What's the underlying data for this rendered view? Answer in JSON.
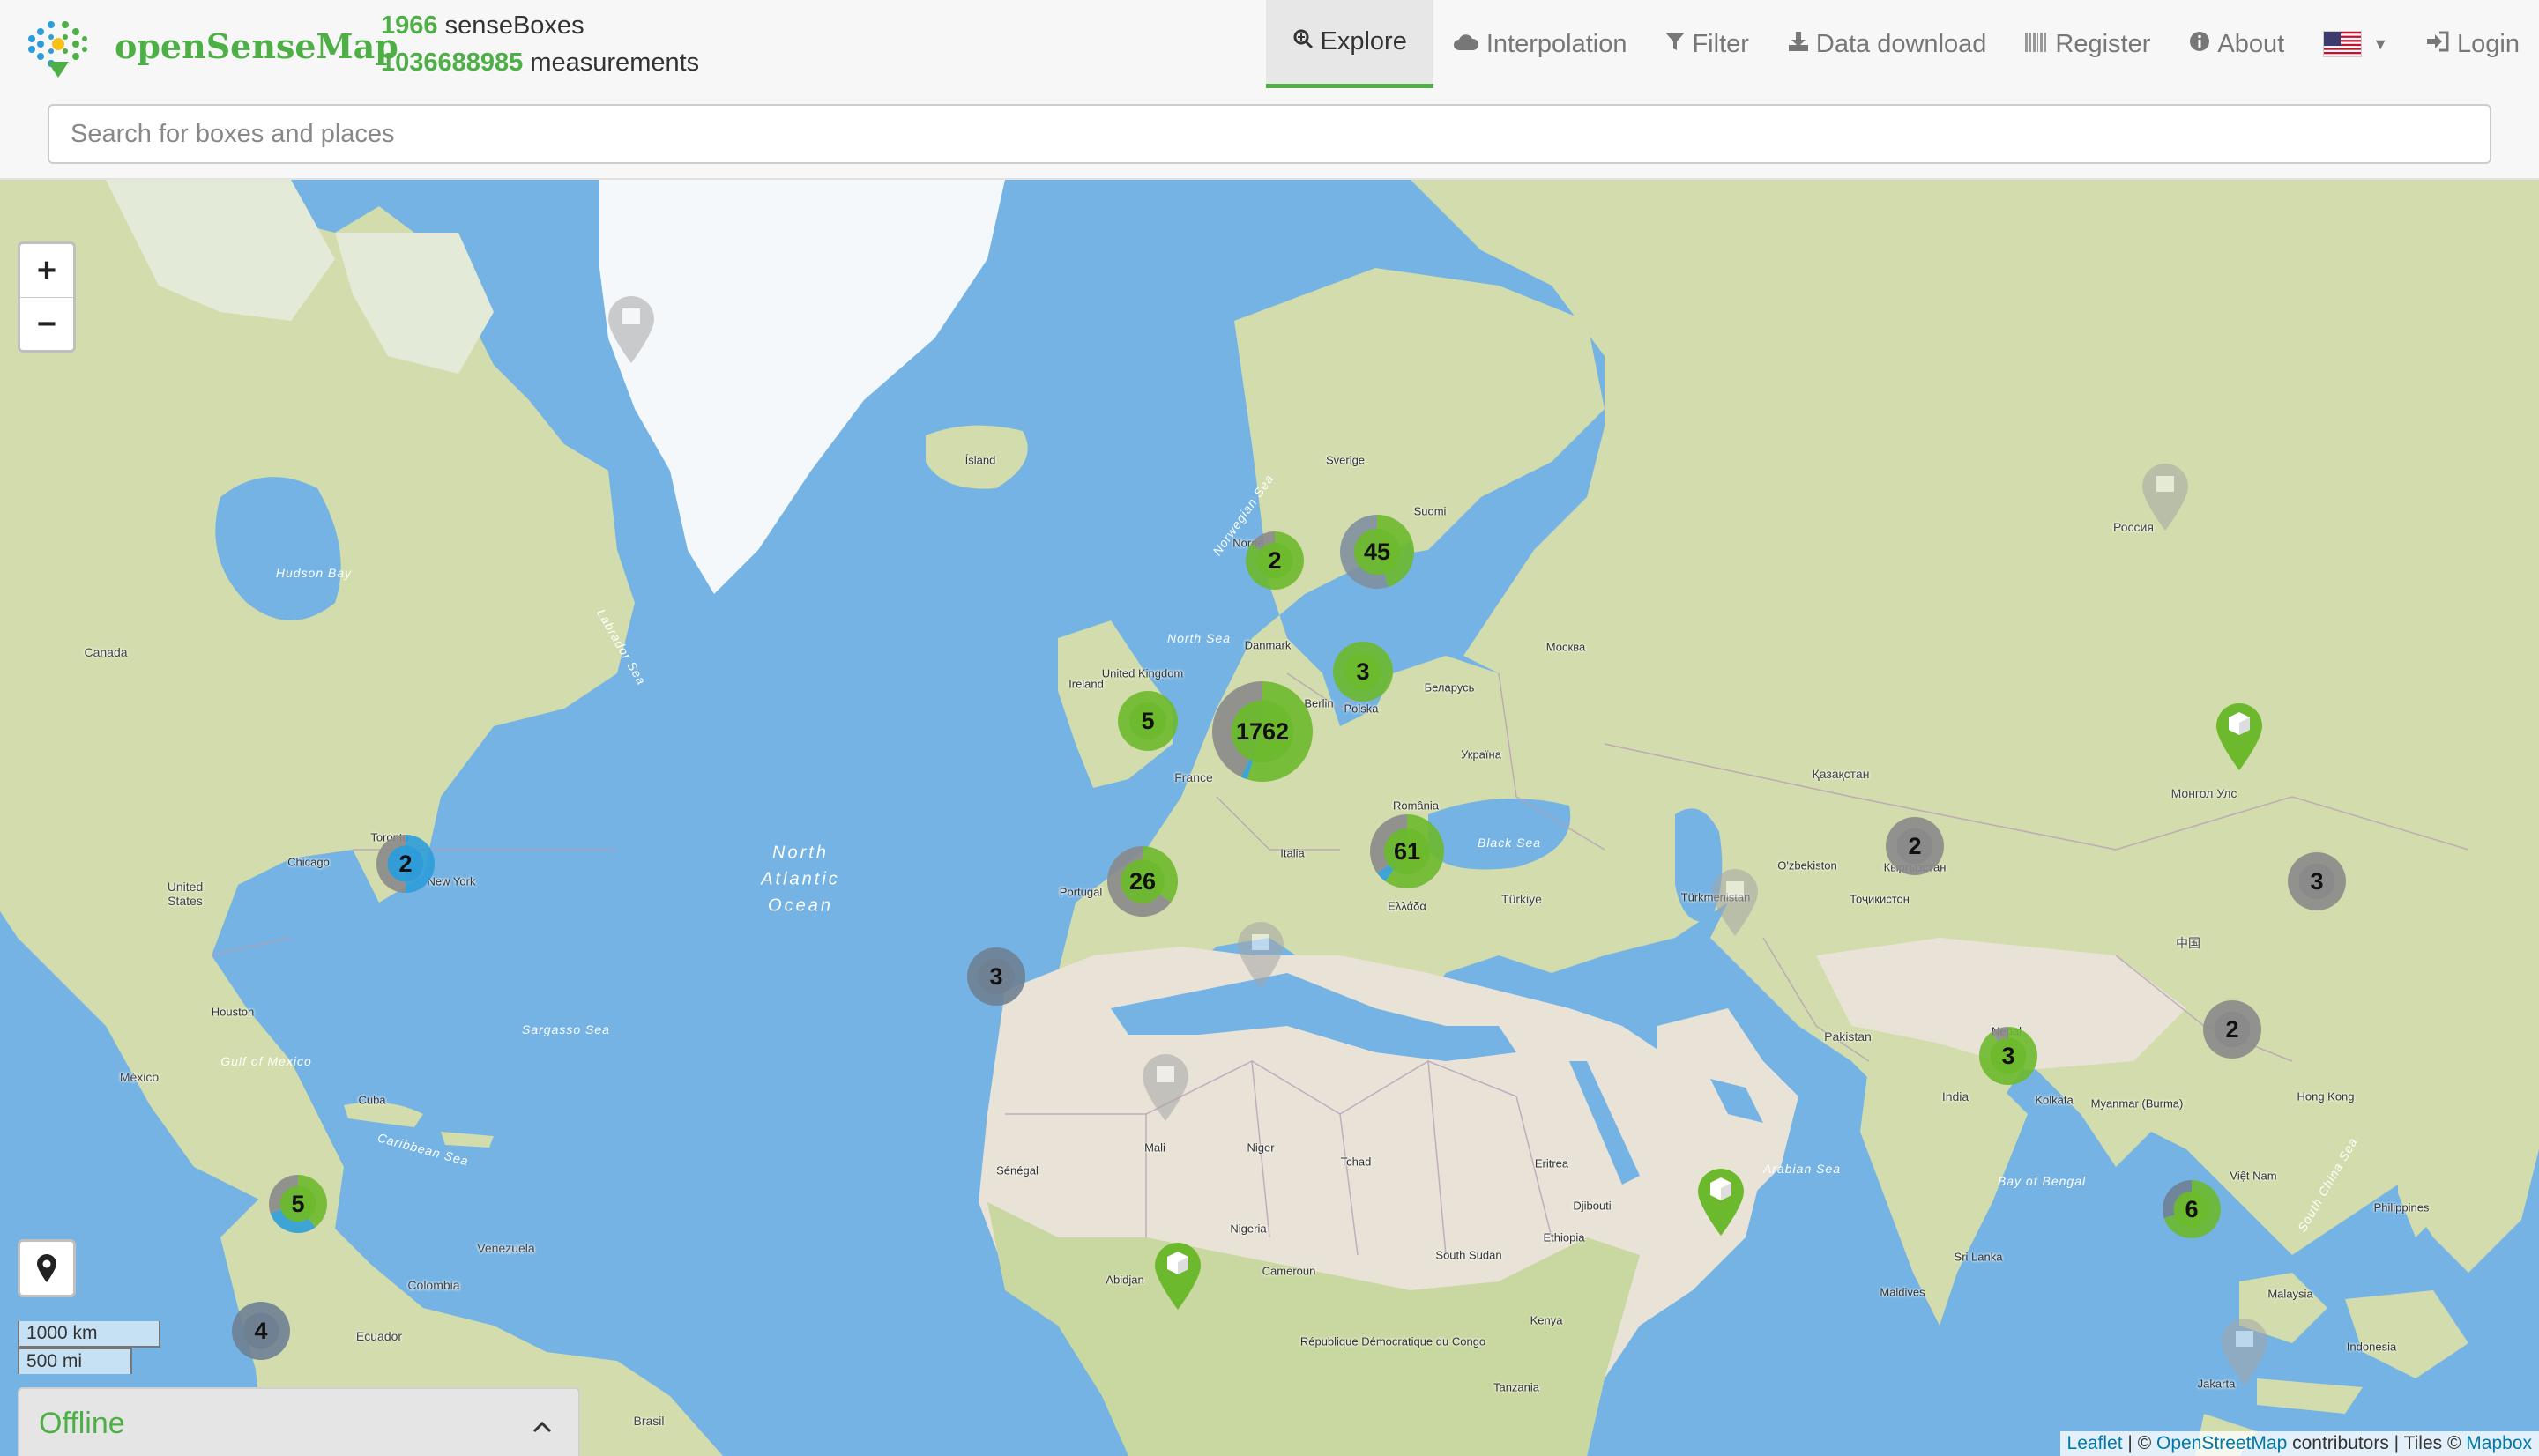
{
  "brand": {
    "name": "openSenseMap"
  },
  "stats": {
    "boxes_count": "1966",
    "boxes_label": "senseBoxes",
    "measurements_count": "1036688985",
    "measurements_label": "measurements"
  },
  "nav": {
    "explore": "Explore",
    "interpolation": "Interpolation",
    "filter": "Filter",
    "download": "Data download",
    "register": "Register",
    "about": "About",
    "login": "Login"
  },
  "search": {
    "placeholder": "Search for boxes and places",
    "value": ""
  },
  "map": {
    "zoom_in": "+",
    "zoom_out": "−",
    "scale_km": "1000 km",
    "scale_mi": "500 mi",
    "offline_label": "Offline",
    "offline_toggle": "⌃",
    "attribution": {
      "leaflet": "Leaflet",
      "separator": " | © ",
      "osm": "OpenStreetMap",
      "contributors": " contributors | Tiles © ",
      "mapbox": "Mapbox"
    },
    "clusters": [
      "2",
      "45",
      "5",
      "1762",
      "3",
      "2",
      "26",
      "61",
      "3",
      "5",
      "4",
      "2",
      "3",
      "2",
      "3",
      "6"
    ],
    "labels": {
      "north_atlantic_1": "North",
      "north_atlantic_2": "Atlantic",
      "north_atlantic_3": "Ocean",
      "labrador_sea": "Labrador Sea",
      "caribbean_sea": "Caribbean Sea",
      "arabian_sea": "Arabian Sea",
      "bay_of_bengal": "Bay of Bengal",
      "south_china_sea": "South China Sea",
      "norwegian_sea": "Norwegian Sea",
      "hudson_bay": "Hudson Bay",
      "gulf_of_mexico": "Gulf of Mexico",
      "sargasso_sea": "Sargasso Sea",
      "black_sea": "Black Sea",
      "north_sea": "North Sea",
      "canada": "Canada",
      "united_states_1": "United",
      "united_states_2": "States",
      "mexico": "México",
      "cuba": "Cuba",
      "venezuela": "Venezuela",
      "colombia": "Colombia",
      "ecuador": "Ecuador",
      "brasil": "Brasil",
      "island": "Ísland",
      "ireland": "Ireland",
      "united_kingdom": "United Kingdom",
      "france": "France",
      "portugal": "Portugal",
      "italia": "Italia",
      "polska": "Polska",
      "belarus": "Беларусь",
      "ukraina": "Україна",
      "romania": "România",
      "turkiye": "Türkiye",
      "ellada": "Ελλάδα",
      "suomi": "Suomi",
      "sverige": "Sverige",
      "norge": "Norge",
      "danmark": "Danmark",
      "rossiya": "Россия",
      "kazakhstan": "Қазақстан",
      "mongolia": "Монгол Улс",
      "china": "中国",
      "india": "India",
      "pakistan": "Pakistan",
      "nepal": "Nepal",
      "myanmar": "Myanmar (Burma)",
      "viet_nam": "Việt Nam",
      "philippines": "Philippines",
      "malaysia": "Malaysia",
      "indonesia": "Indonesia",
      "sri_lanka": "Sri Lanka",
      "maldives": "Maldives",
      "mali": "Mali",
      "niger": "Niger",
      "tchad": "Tchad",
      "nigeria": "Nigeria",
      "ethiopia": "Ethiopia",
      "kenya": "Kenya",
      "tanzania": "Tanzania",
      "south_sudan": "South Sudan",
      "senegal": "Sénégal",
      "eritrea": "Eritrea",
      "djibouti": "Djibouti",
      "cameroun": "Cameroun",
      "rdc": "République Démocratique du Congo",
      "uzbekistan": "O'zbekiston",
      "turkmenistan": "Türkmenistan",
      "kyrgyzstan": "Кыргызстан",
      "tajikistan": "Тоҷикистон",
      "moskva": "Москва",
      "berlin": "Berlin",
      "new_york": "New York",
      "toronto": "Toronto",
      "chicago": "Chicago",
      "houston": "Houston",
      "jakarta": "Jakarta",
      "abidjan": "Abidjan",
      "kolkata": "Kolkata",
      "hong_kong": "Hong Kong"
    }
  },
  "colors": {
    "brand_green": "#4eaf47",
    "water": "#74b3e3",
    "land": "#d6dfb4",
    "desert": "#e8e3d6",
    "ice": "#f4f8fb",
    "cluster_grey": "#8a8a8a",
    "cluster_blue": "#2e9cd9",
    "link_blue": "#0078a8"
  }
}
